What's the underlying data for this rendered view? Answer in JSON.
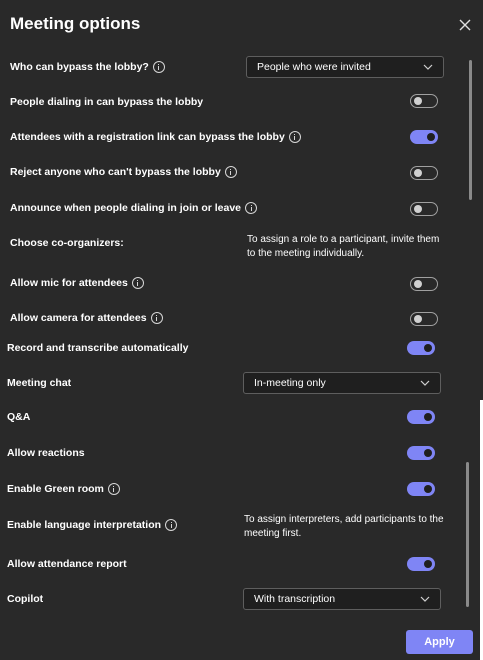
{
  "header": {
    "title": "Meeting options"
  },
  "settings": {
    "bypass_lobby": {
      "label": "Who can bypass the lobby?",
      "value": "People who were invited"
    },
    "dial_in_bypass": {
      "label": "People dialing in can bypass the lobby",
      "on": false
    },
    "registration_bypass": {
      "label": "Attendees with a registration link can bypass the lobby",
      "on": true
    },
    "reject_bypass": {
      "label": "Reject anyone who can't bypass the lobby",
      "on": false
    },
    "announce_dial_in": {
      "label": "Announce when people dialing in join or leave",
      "on": false
    },
    "co_organizers": {
      "label": "Choose co-organizers:",
      "note": "To assign a role to a participant, invite them to the meeting individually."
    },
    "allow_mic": {
      "label": "Allow mic for attendees",
      "on": false
    },
    "allow_camera": {
      "label": "Allow camera for attendees",
      "on": false
    },
    "record_transcribe": {
      "label": "Record and transcribe automatically",
      "on": true
    },
    "meeting_chat": {
      "label": "Meeting chat",
      "value": "In-meeting only"
    },
    "qa": {
      "label": "Q&A",
      "on": true
    },
    "reactions": {
      "label": "Allow reactions",
      "on": true
    },
    "green_room": {
      "label": "Enable Green room",
      "on": true
    },
    "language_interpretation": {
      "label": "Enable language interpretation",
      "note": "To assign interpreters, add participants to the meeting first."
    },
    "attendance_report": {
      "label": "Allow attendance report",
      "on": true
    },
    "copilot": {
      "label": "Copilot",
      "value": "With transcription"
    }
  },
  "footer": {
    "apply_label": "Apply"
  },
  "colors": {
    "background": "#292929",
    "accent": "#7f85f5",
    "input_bg": "#1f1f1f"
  }
}
